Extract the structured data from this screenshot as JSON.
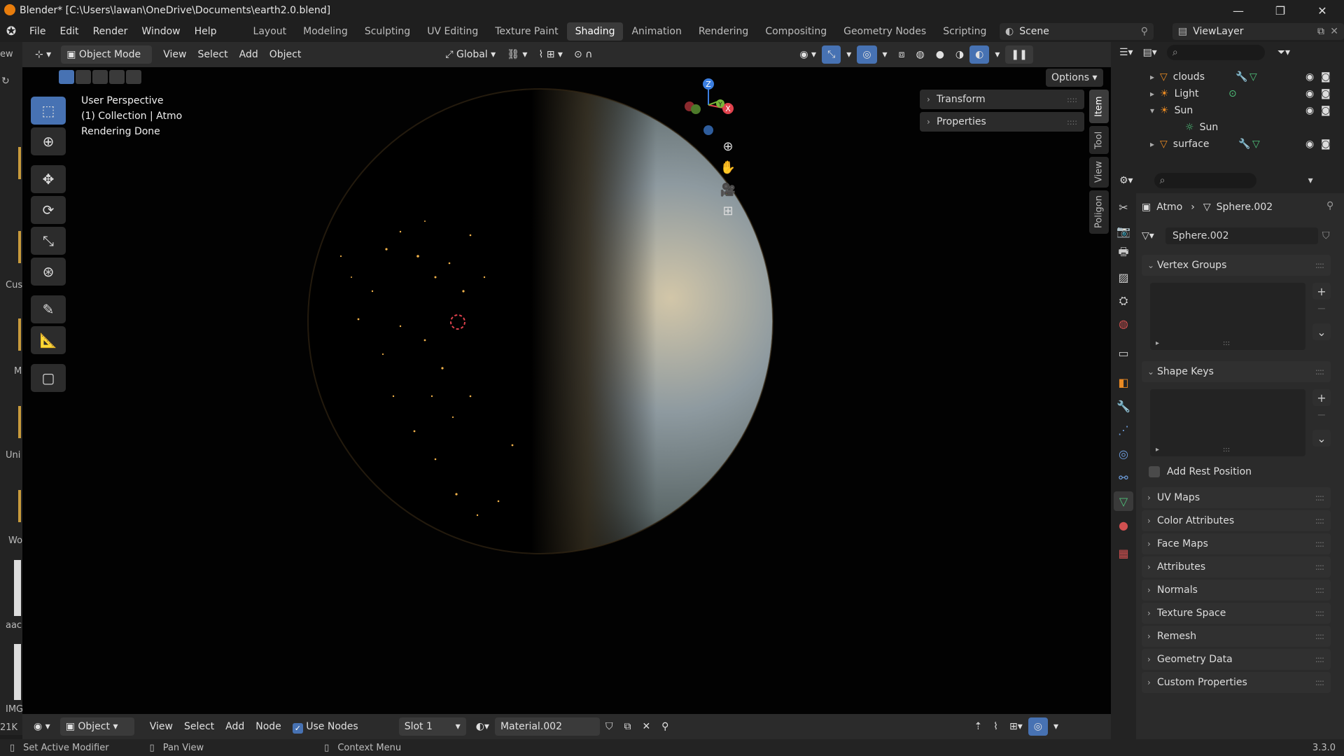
{
  "window": {
    "title": "Blender* [C:\\Users\\lawan\\OneDrive\\Documents\\earth2.0.blend]",
    "minimize": "—",
    "maximize": "❐",
    "close": "✕"
  },
  "menu": [
    "File",
    "Edit",
    "Render",
    "Window",
    "Help"
  ],
  "workspaces": [
    "Layout",
    "Modeling",
    "Sculpting",
    "UV Editing",
    "Texture Paint",
    "Shading",
    "Animation",
    "Rendering",
    "Compositing",
    "Geometry Nodes",
    "Scripting",
    "+"
  ],
  "active_workspace": "Shading",
  "scene": "Scene",
  "view_layer": "ViewLayer",
  "left_strip": {
    "top": "ew",
    "labels": [
      "Cus",
      "M",
      "Uni",
      "Wo",
      "aac",
      "IMG",
      "21K"
    ]
  },
  "viewport_header": {
    "mode": "Object Mode",
    "menus": [
      "View",
      "Select",
      "Add",
      "Object"
    ],
    "orientation": "Global",
    "options": "Options"
  },
  "viewport": {
    "line1": "User Perspective",
    "line2": "(1) Collection | Atmo",
    "line3": "Rendering Done",
    "gizmo": {
      "z": "Z",
      "y": "Y",
      "x": "X"
    }
  },
  "n_panel": {
    "rows": [
      "Transform",
      "Properties"
    ],
    "tabs": [
      "Item",
      "Tool",
      "View",
      "Poligon"
    ],
    "active_tab": "Item"
  },
  "outliner": {
    "items": [
      {
        "name": "clouds",
        "indent": 0,
        "expanded": false
      },
      {
        "name": "Light",
        "indent": 0,
        "expanded": false
      },
      {
        "name": "Sun",
        "indent": 0,
        "expanded": true
      },
      {
        "name": "Sun",
        "indent": 1,
        "expanded": false
      },
      {
        "name": "surface",
        "indent": 0,
        "expanded": false
      }
    ]
  },
  "properties": {
    "breadcrumb_object": "Atmo",
    "breadcrumb_data": "Sphere.002",
    "datablock": "Sphere.002",
    "panels_open": [
      "Vertex Groups",
      "Shape Keys"
    ],
    "add_rest_position": "Add Rest Position",
    "panels_closed": [
      "UV Maps",
      "Color Attributes",
      "Face Maps",
      "Attributes",
      "Normals",
      "Texture Space",
      "Remesh",
      "Geometry Data",
      "Custom Properties"
    ]
  },
  "shader_header": {
    "object": "Object",
    "menus": [
      "View",
      "Select",
      "Add",
      "Node"
    ],
    "use_nodes": "Use Nodes",
    "slot": "Slot 1",
    "material": "Material.002"
  },
  "status": {
    "left": "Set Active Modifier",
    "middle": "Pan View",
    "right": "Context Menu",
    "version": "3.3.0"
  },
  "colors": {
    "accent": "#4772b3",
    "active_tab": "#3a3a3a",
    "gizmo_x": "#e0424d",
    "gizmo_y": "#76b538",
    "gizmo_z": "#3b7ee0"
  }
}
